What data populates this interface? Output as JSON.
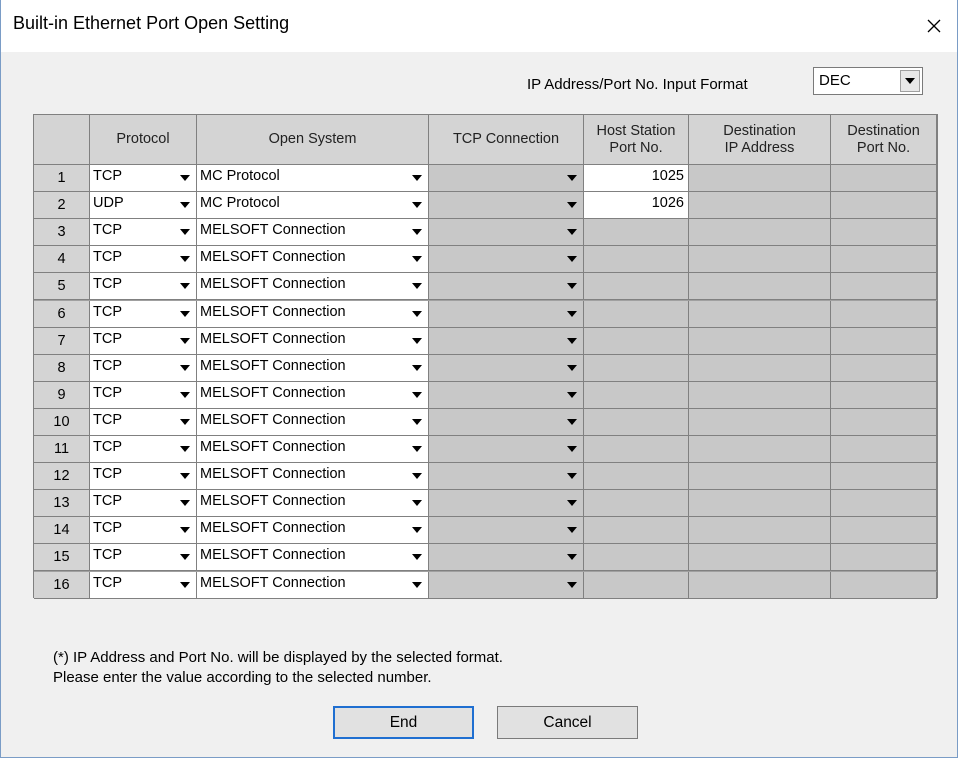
{
  "window": {
    "title": "Built-in Ethernet Port Open Setting",
    "close_symbol": "✕"
  },
  "input_format": {
    "label": "IP Address/Port No. Input Format",
    "value": "DEC"
  },
  "table": {
    "headers": {
      "protocol": "Protocol",
      "open_system": "Open System",
      "tcp_connection": "TCP Connection",
      "host_port_line1": "Host Station",
      "host_port_line2": "Port No.",
      "dest_ip_line1": "Destination",
      "dest_ip_line2": "IP Address",
      "dest_port_line1": "Destination",
      "dest_port_line2": "Port No."
    },
    "rows": [
      {
        "no": "1",
        "protocol": "TCP",
        "open_system": "MC Protocol",
        "tcp_connection": "",
        "host_port": "1025",
        "editable_port": true
      },
      {
        "no": "2",
        "protocol": "UDP",
        "open_system": "MC Protocol",
        "tcp_connection": "",
        "host_port": "1026",
        "editable_port": true
      },
      {
        "no": "3",
        "protocol": "TCP",
        "open_system": "MELSOFT Connection",
        "tcp_connection": "",
        "host_port": "",
        "editable_port": false
      },
      {
        "no": "4",
        "protocol": "TCP",
        "open_system": "MELSOFT Connection",
        "tcp_connection": "",
        "host_port": "",
        "editable_port": false
      },
      {
        "no": "5",
        "protocol": "TCP",
        "open_system": "MELSOFT Connection",
        "tcp_connection": "",
        "host_port": "",
        "editable_port": false
      },
      {
        "no": "6",
        "protocol": "TCP",
        "open_system": "MELSOFT Connection",
        "tcp_connection": "",
        "host_port": "",
        "editable_port": false
      },
      {
        "no": "7",
        "protocol": "TCP",
        "open_system": "MELSOFT Connection",
        "tcp_connection": "",
        "host_port": "",
        "editable_port": false
      },
      {
        "no": "8",
        "protocol": "TCP",
        "open_system": "MELSOFT Connection",
        "tcp_connection": "",
        "host_port": "",
        "editable_port": false
      },
      {
        "no": "9",
        "protocol": "TCP",
        "open_system": "MELSOFT Connection",
        "tcp_connection": "",
        "host_port": "",
        "editable_port": false
      },
      {
        "no": "10",
        "protocol": "TCP",
        "open_system": "MELSOFT Connection",
        "tcp_connection": "",
        "host_port": "",
        "editable_port": false
      },
      {
        "no": "11",
        "protocol": "TCP",
        "open_system": "MELSOFT Connection",
        "tcp_connection": "",
        "host_port": "",
        "editable_port": false
      },
      {
        "no": "12",
        "protocol": "TCP",
        "open_system": "MELSOFT Connection",
        "tcp_connection": "",
        "host_port": "",
        "editable_port": false
      },
      {
        "no": "13",
        "protocol": "TCP",
        "open_system": "MELSOFT Connection",
        "tcp_connection": "",
        "host_port": "",
        "editable_port": false
      },
      {
        "no": "14",
        "protocol": "TCP",
        "open_system": "MELSOFT Connection",
        "tcp_connection": "",
        "host_port": "",
        "editable_port": false
      },
      {
        "no": "15",
        "protocol": "TCP",
        "open_system": "MELSOFT Connection",
        "tcp_connection": "",
        "host_port": "",
        "editable_port": false
      },
      {
        "no": "16",
        "protocol": "TCP",
        "open_system": "MELSOFT Connection",
        "tcp_connection": "",
        "host_port": "",
        "editable_port": false
      }
    ]
  },
  "footnote": {
    "line1": "(*) IP Address and Port No. will be displayed by the selected format.",
    "line2": "Please enter the value according to the selected number."
  },
  "buttons": {
    "end": "End",
    "cancel": "Cancel"
  },
  "icons": {
    "dropdown": "triangle-down-icon",
    "close": "close-icon"
  }
}
